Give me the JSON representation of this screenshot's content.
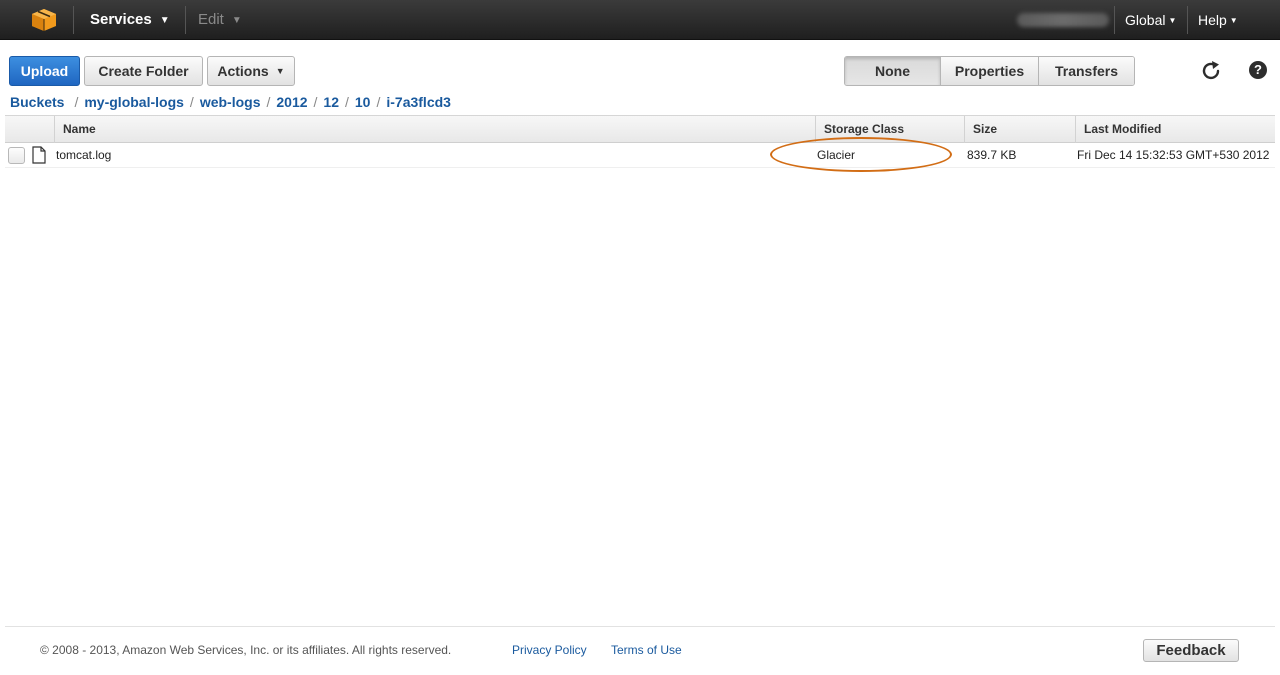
{
  "nav": {
    "services": "Services",
    "edit": "Edit",
    "region": "Global",
    "help": "Help"
  },
  "toolbar": {
    "upload": "Upload",
    "create_folder": "Create Folder",
    "actions": "Actions",
    "view_none": "None",
    "view_properties": "Properties",
    "view_transfers": "Transfers"
  },
  "breadcrumb": [
    "Buckets",
    "my-global-logs",
    "web-logs",
    "2012",
    "12",
    "10",
    "i-7a3flcd3"
  ],
  "table": {
    "columns": {
      "name": "Name",
      "storage_class": "Storage Class",
      "size": "Size",
      "last_modified": "Last Modified"
    },
    "rows": [
      {
        "name": "tomcat.log",
        "storage_class": "Glacier",
        "size": "839.7 KB",
        "last_modified": "Fri Dec 14 15:32:53 GMT+530 2012"
      }
    ]
  },
  "footer": {
    "copyright": "© 2008 - 2013, Amazon Web Services, Inc. or its affiliates. All rights reserved.",
    "privacy": "Privacy Policy",
    "terms": "Terms of Use",
    "feedback": "Feedback"
  },
  "colors": {
    "primary_button": "#1f66c1",
    "link": "#1a5a9e",
    "highlight": "#d26d15",
    "nav_bg": "#2a2a2a"
  },
  "icons": {
    "logo": "aws-cube-logo",
    "refresh": "refresh-icon",
    "help": "help-icon",
    "file": "file-icon"
  }
}
